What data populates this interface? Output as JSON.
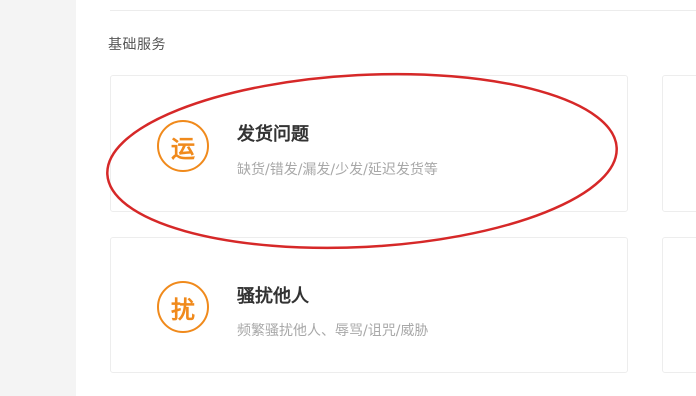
{
  "section": {
    "title": "基础服务"
  },
  "services": [
    {
      "icon_text": "运",
      "icon": "yun-circle-icon",
      "title": "发货问题",
      "description": "缺货/错发/漏发/少发/延迟发货等"
    },
    {
      "icon_text": "扰",
      "icon": "rao-circle-icon",
      "title": "骚扰他人",
      "description": "频繁骚扰他人、辱骂/诅咒/威胁"
    }
  ],
  "colors": {
    "accent": "#f08a1c",
    "annotation": "#d62828",
    "title_text": "#333333",
    "desc_text": "#a8a8a8"
  }
}
